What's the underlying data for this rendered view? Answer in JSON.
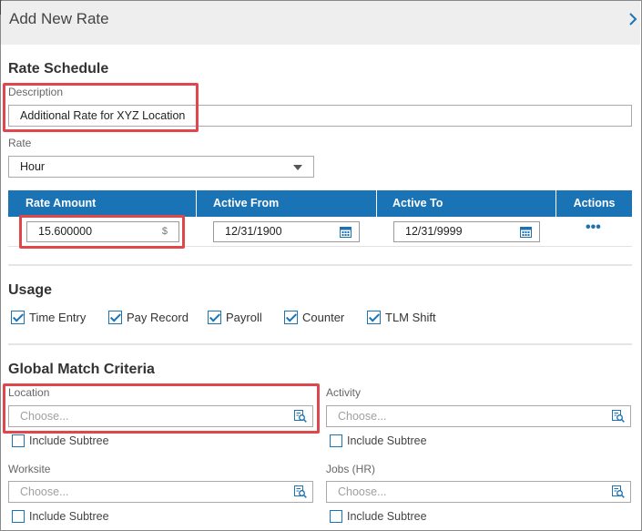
{
  "header": {
    "title": "Add New Rate"
  },
  "rate_schedule": {
    "section_title": "Rate Schedule",
    "description_label": "Description",
    "description_value": "Additional Rate for XYZ Location",
    "rate_label": "Rate",
    "rate_value": "Hour"
  },
  "rate_table": {
    "columns": [
      "Rate Amount",
      "Active From",
      "Active To",
      "Actions"
    ],
    "row": {
      "rate_amount": "15.600000",
      "currency_symbol": "$",
      "active_from": "12/31/1900",
      "active_to": "12/31/9999",
      "actions": "•••"
    }
  },
  "usage": {
    "section_title": "Usage",
    "items": [
      {
        "label": "Time Entry",
        "checked": true
      },
      {
        "label": "Pay Record",
        "checked": true
      },
      {
        "label": "Payroll",
        "checked": true
      },
      {
        "label": "Counter",
        "checked": true
      },
      {
        "label": "TLM Shift",
        "checked": true
      }
    ]
  },
  "global_match": {
    "section_title": "Global Match Criteria",
    "fields": [
      {
        "label": "Location",
        "placeholder": "Choose...",
        "subtree_label": "Include Subtree",
        "subtree_checked": false
      },
      {
        "label": "Activity",
        "placeholder": "Choose...",
        "subtree_label": "Include Subtree",
        "subtree_checked": false
      },
      {
        "label": "Worksite",
        "placeholder": "Choose...",
        "subtree_label": "Include Subtree",
        "subtree_checked": false
      },
      {
        "label": "Jobs (HR)",
        "placeholder": "Choose...",
        "subtree_label": "Include Subtree",
        "subtree_checked": false
      }
    ]
  },
  "colors": {
    "accent": "#1a73b5",
    "header_bg": "#eeeeee",
    "highlight": "#e0474c"
  },
  "icons": {
    "collapse": "chevron-right-icon",
    "dropdown": "caret-down-icon",
    "date": "calendar-icon",
    "lookup": "search-list-icon",
    "actions": "ellipsis-icon"
  }
}
